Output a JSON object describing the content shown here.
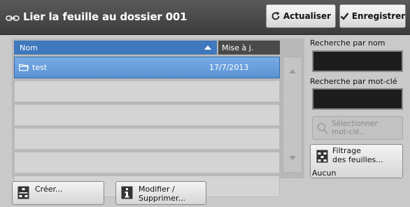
{
  "titlebar": {
    "title": "Lier la feuille au dossier 001",
    "refresh_label": "Actualiser",
    "save_label": "Enregistrer"
  },
  "list": {
    "columns": {
      "name": "Nom",
      "date": "Mise à j."
    },
    "sort": "name-ascending",
    "rows": [
      {
        "name": "test",
        "date": "17/7/2013",
        "selected": true,
        "icon": "folder-icon"
      },
      {
        "name": "",
        "date": ""
      },
      {
        "name": "",
        "date": ""
      },
      {
        "name": "",
        "date": ""
      },
      {
        "name": "",
        "date": ""
      },
      {
        "name": "",
        "date": ""
      }
    ]
  },
  "search": {
    "by_name_label": "Recherche par nom",
    "by_name_value": "",
    "by_keyword_label": "Recherche par mot-clé",
    "by_keyword_value": "",
    "select_keyword_line1": "Sélectionner",
    "select_keyword_line2": "mot-clé..."
  },
  "filter": {
    "label_line1": "Filtrage",
    "label_line2": "des feuilles...",
    "status": "Aucun"
  },
  "bottom": {
    "create_label": "Créer...",
    "modify_line1": "Modifier /",
    "modify_line2": "Supprimer..."
  },
  "colors": {
    "title_bar": "#464646",
    "header_name": "#3f78bd",
    "header_date": "#4a4a4a",
    "row_selected": "#5b93d3",
    "background": "#c9c9c9"
  }
}
